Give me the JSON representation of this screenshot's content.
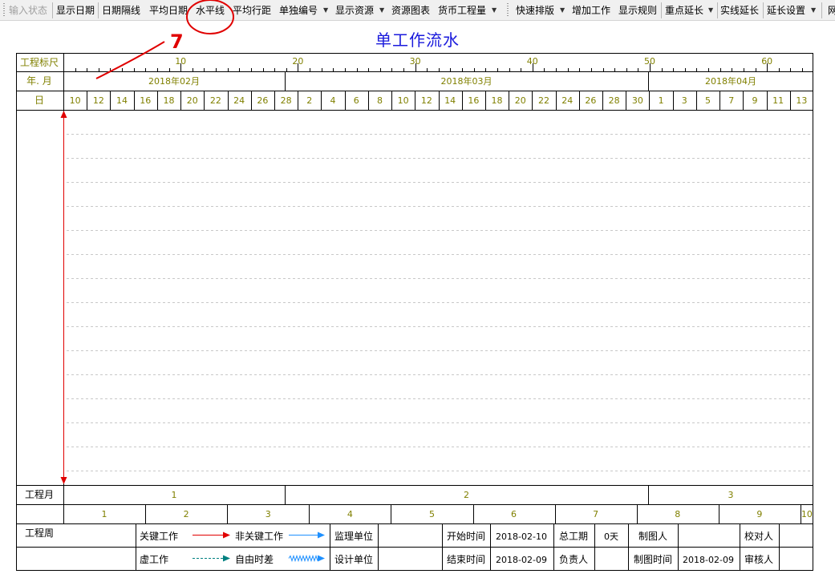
{
  "toolbar": {
    "input_state": "输入状态",
    "show_date": "显示日期",
    "date_gap": "日期隔线",
    "avg_date": "平均日期",
    "hline": "水平线",
    "avg_row": "平均行距",
    "single_number": "单独编号",
    "show_resource": "显示资源",
    "resource_chart": "资源图表",
    "currency_qty": "货币工程量",
    "quick_layout": "快速排版",
    "add_work": "增加工作",
    "show_rules": "显示规则",
    "key_extend": "重点延长",
    "solid_extend": "实线延长",
    "extend_settings": "延长设置",
    "cut_item": "网"
  },
  "chart": {
    "title": "单工作流水",
    "row_labels": {
      "ruler": "工程标尺",
      "month": "年. 月",
      "day": "日",
      "proj_month": "工程月",
      "proj_week": "工程周"
    },
    "ruler_ticks": [
      "10",
      "20",
      "30",
      "40",
      "50",
      "60"
    ],
    "months": [
      "2018年02月",
      "2018年03月",
      "2018年04月"
    ],
    "days": [
      "10",
      "12",
      "14",
      "16",
      "18",
      "20",
      "22",
      "24",
      "26",
      "28",
      "2",
      "4",
      "6",
      "8",
      "10",
      "12",
      "14",
      "16",
      "18",
      "20",
      "22",
      "24",
      "26",
      "28",
      "30",
      "1",
      "3",
      "5",
      "7",
      "9",
      "11",
      "13"
    ],
    "proj_months": [
      "1",
      "2",
      "3"
    ],
    "proj_weeks": [
      "1",
      "2",
      "3",
      "4",
      "5",
      "6",
      "7",
      "8",
      "9",
      "10"
    ],
    "colors": {
      "accent_text": "#808000",
      "title": "#1a1adc",
      "critical": "#e00000",
      "noncritical": "#1e90ff",
      "dummy": "#008080",
      "annotation": "#e00000"
    }
  },
  "legend": {
    "critical": "关键工作",
    "noncritical": "非关键工作",
    "dummy": "虚工作",
    "free_float": "自由时差"
  },
  "info": {
    "supervisor": "监理单位",
    "designer": "设计单位",
    "start_label": "开始时间",
    "start_value": "2018-02-10",
    "end_label": "结束时间",
    "end_value": "2018-02-09",
    "duration_label": "总工期",
    "duration_value": "0天",
    "owner_label": "负责人",
    "drafter_label": "制图人",
    "draw_time_label": "制图时间",
    "draw_time_value": "2018-02-09",
    "proofreader_label": "校对人",
    "reviewer_label": "审核人"
  },
  "annotation": {
    "mark": "7"
  }
}
